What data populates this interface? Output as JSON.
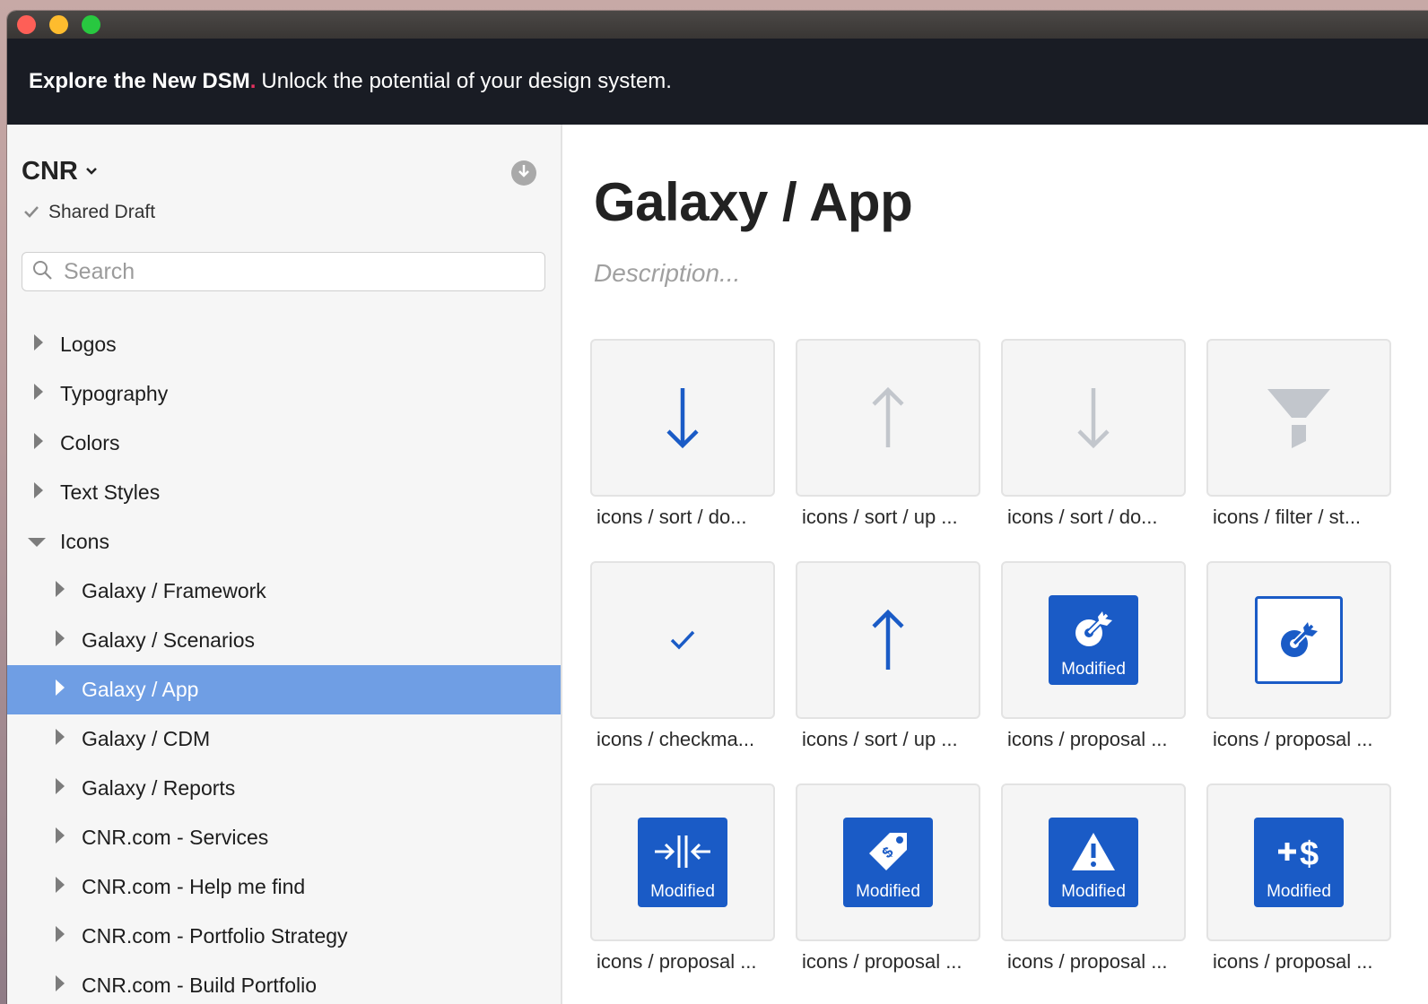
{
  "banner": {
    "bold": "Explore the New DSM",
    "dot": ".",
    "rest": "Unlock the potential of your design system."
  },
  "sidebar": {
    "project": "CNR",
    "status": "Shared Draft",
    "search_placeholder": "Search",
    "tree": [
      {
        "label": "Logos",
        "level": 1,
        "expanded": false
      },
      {
        "label": "Typography",
        "level": 1,
        "expanded": false
      },
      {
        "label": "Colors",
        "level": 1,
        "expanded": false
      },
      {
        "label": "Text Styles",
        "level": 1,
        "expanded": false
      },
      {
        "label": "Icons",
        "level": 1,
        "expanded": true
      },
      {
        "label": "Galaxy / Framework",
        "level": 2,
        "expanded": false
      },
      {
        "label": "Galaxy / Scenarios",
        "level": 2,
        "expanded": false
      },
      {
        "label": "Galaxy / App",
        "level": 2,
        "expanded": false,
        "selected": true
      },
      {
        "label": "Galaxy / CDM",
        "level": 2,
        "expanded": false
      },
      {
        "label": "Galaxy / Reports",
        "level": 2,
        "expanded": false
      },
      {
        "label": "CNR.com - Services",
        "level": 2,
        "expanded": false
      },
      {
        "label": "CNR.com - Help me find",
        "level": 2,
        "expanded": false
      },
      {
        "label": "CNR.com - Portfolio Strategy",
        "level": 2,
        "expanded": false
      },
      {
        "label": "CNR.com - Build Portfolio",
        "level": 2,
        "expanded": false
      }
    ]
  },
  "main": {
    "title": "Galaxy / App",
    "description_placeholder": "Description...",
    "tiles": [
      {
        "caption": "icons / sort / do...",
        "icon": "arrow-down-icon",
        "badge": ""
      },
      {
        "caption": "icons / sort / up ...",
        "icon": "arrow-up-light-icon",
        "badge": ""
      },
      {
        "caption": "icons / sort / do...",
        "icon": "arrow-down-light-icon",
        "badge": ""
      },
      {
        "caption": "icons / filter / st...",
        "icon": "filter-icon",
        "badge": ""
      },
      {
        "caption": "icons / checkma...",
        "icon": "checkmark-icon",
        "badge": ""
      },
      {
        "caption": "icons / sort / up ...",
        "icon": "arrow-up-icon",
        "badge": ""
      },
      {
        "caption": "icons / proposal ...",
        "icon": "proposal-target-icon",
        "badge": "Modified"
      },
      {
        "caption": "icons / proposal ...",
        "icon": "proposal-target-outline-icon",
        "badge": ""
      },
      {
        "caption": "icons / proposal ...",
        "icon": "proposal-merge-icon",
        "badge": "Modified"
      },
      {
        "caption": "icons / proposal ...",
        "icon": "proposal-price-tag-icon",
        "badge": "Modified"
      },
      {
        "caption": "icons / proposal ...",
        "icon": "proposal-warning-icon",
        "badge": "Modified"
      },
      {
        "caption": "icons / proposal ...",
        "icon": "proposal-add-dollar-icon",
        "badge": "Modified"
      }
    ]
  },
  "colors": {
    "accent": "#1a5bc6",
    "selection": "#6f9ee4",
    "banner_bg": "#191c24",
    "banner_dot": "#e5315f"
  }
}
